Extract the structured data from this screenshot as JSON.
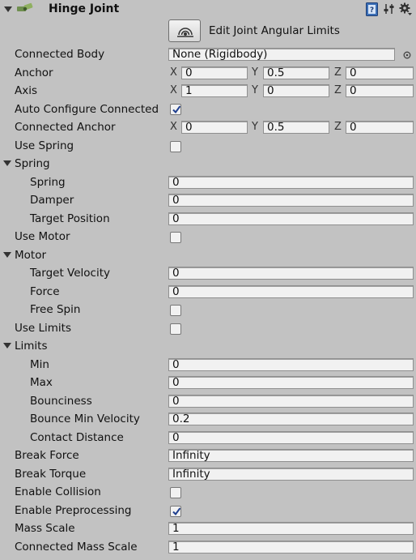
{
  "header": {
    "title": "Hinge Joint",
    "icons": [
      "expand-caret-icon",
      "hinge-joint-component-icon",
      "help-book-icon",
      "presets-sliders-icon",
      "settings-gear-icon"
    ]
  },
  "edit_button": {
    "label": "Edit Joint Angular Limits",
    "icon": "joint-limits-icon"
  },
  "connected_body": {
    "label": "Connected Body",
    "value": "None (Rigidbody)"
  },
  "anchor": {
    "label": "Anchor",
    "x_label": "X",
    "y_label": "Y",
    "z_label": "Z",
    "x": "0",
    "y": "0.5",
    "z": "0"
  },
  "axis": {
    "label": "Axis",
    "x_label": "X",
    "y_label": "Y",
    "z_label": "Z",
    "x": "1",
    "y": "0",
    "z": "0"
  },
  "auto_configure": {
    "label": "Auto Configure Connected",
    "checked": true
  },
  "connected_anchor": {
    "label": "Connected Anchor",
    "x_label": "X",
    "y_label": "Y",
    "z_label": "Z",
    "x": "0",
    "y": "0.5",
    "z": "0"
  },
  "use_spring": {
    "label": "Use Spring",
    "checked": false
  },
  "spring": {
    "label": "Spring",
    "fields": [
      {
        "label": "Spring",
        "value": "0"
      },
      {
        "label": "Damper",
        "value": "0"
      },
      {
        "label": "Target Position",
        "value": "0"
      }
    ]
  },
  "use_motor": {
    "label": "Use Motor",
    "checked": false
  },
  "motor": {
    "label": "Motor",
    "target_velocity": {
      "label": "Target Velocity",
      "value": "0"
    },
    "force": {
      "label": "Force",
      "value": "0"
    },
    "free_spin": {
      "label": "Free Spin",
      "checked": false
    }
  },
  "use_limits": {
    "label": "Use Limits",
    "checked": false
  },
  "limits": {
    "label": "Limits",
    "fields": [
      {
        "label": "Min",
        "value": "0"
      },
      {
        "label": "Max",
        "value": "0"
      },
      {
        "label": "Bounciness",
        "value": "0"
      },
      {
        "label": "Bounce Min Velocity",
        "value": "0.2"
      },
      {
        "label": "Contact Distance",
        "value": "0"
      }
    ]
  },
  "break_force": {
    "label": "Break Force",
    "value": "Infinity"
  },
  "break_torque": {
    "label": "Break Torque",
    "value": "Infinity"
  },
  "enable_collision": {
    "label": "Enable Collision",
    "checked": false
  },
  "enable_preprocessing": {
    "label": "Enable Preprocessing",
    "checked": true
  },
  "mass_scale": {
    "label": "Mass Scale",
    "value": "1"
  },
  "connected_mass_scale": {
    "label": "Connected Mass Scale",
    "value": "1"
  },
  "colors": {
    "background": "#c2c2c2",
    "field_bg": "#f1f1f1",
    "check": "#1f3f8f",
    "help_icon": "#3b6fb6"
  }
}
